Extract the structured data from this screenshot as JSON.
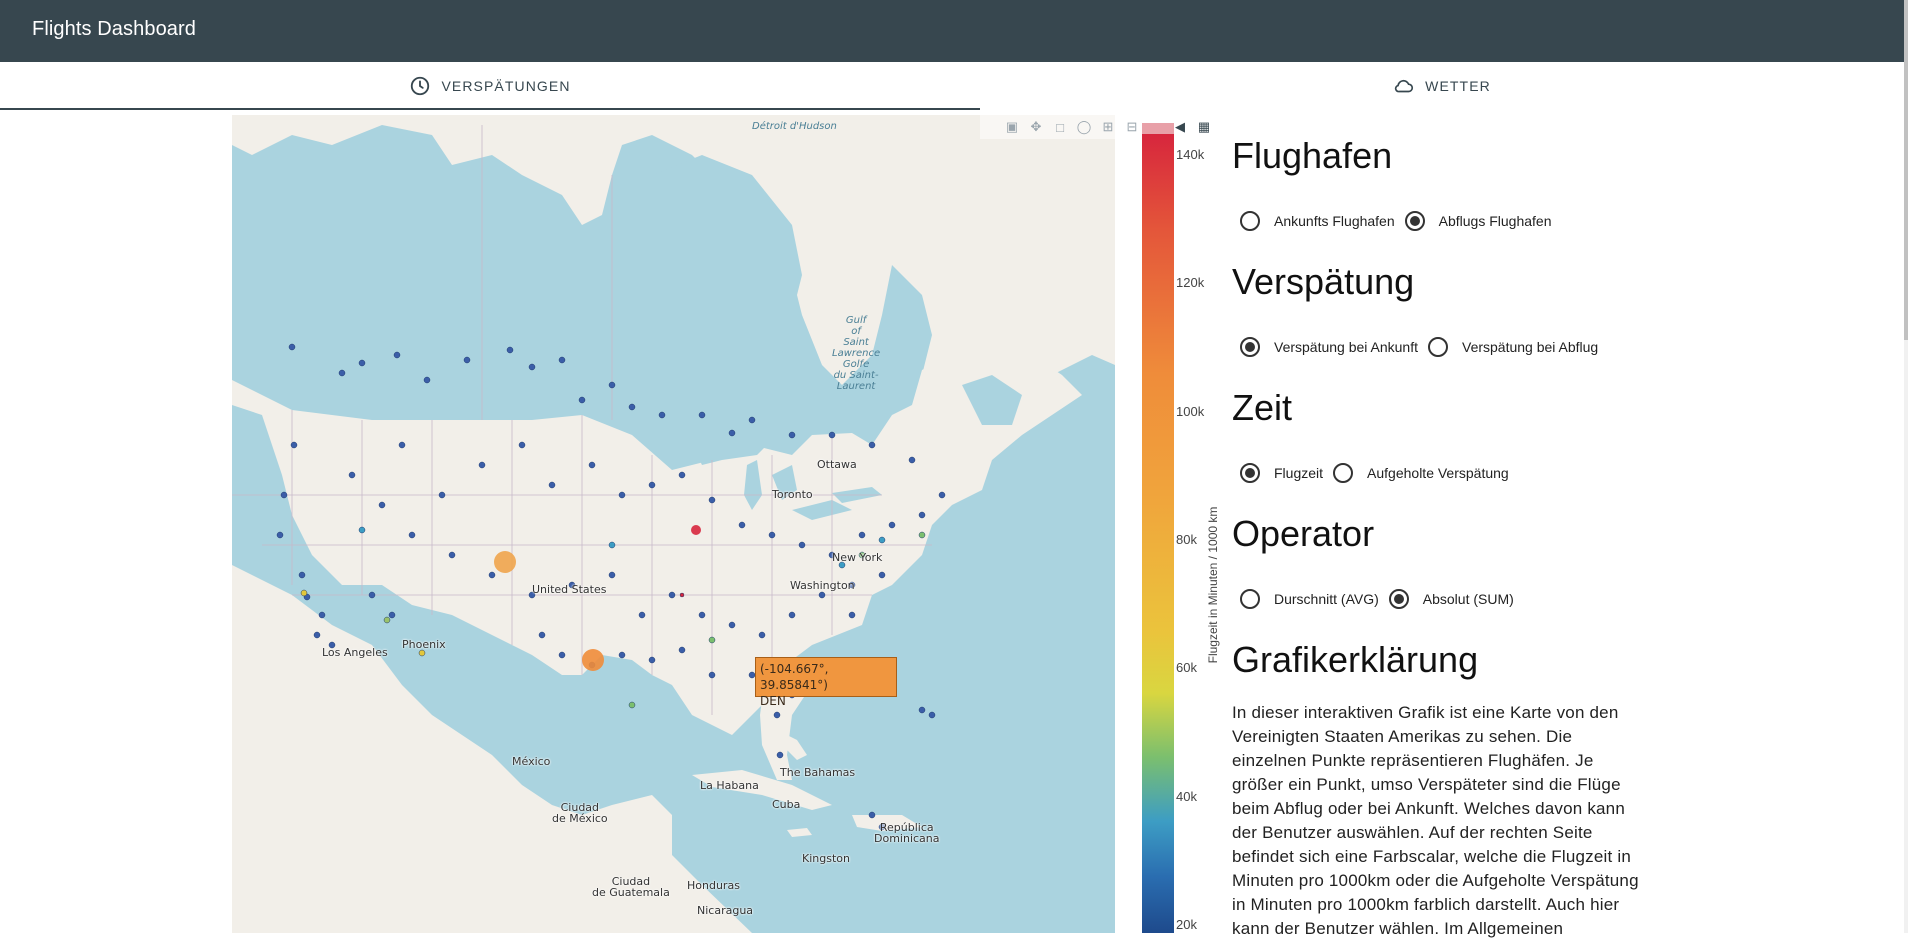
{
  "app": {
    "title": "Flights Dashboard"
  },
  "tabs": [
    {
      "label": "VERSPÄTUNGEN",
      "icon": "clock-icon",
      "active": true
    },
    {
      "label": "WETTER",
      "icon": "cloud-icon",
      "active": false
    }
  ],
  "map": {
    "labels": {
      "ottawa": "Ottawa",
      "toronto": "Toronto",
      "newyork": "New York",
      "washington": "Washington",
      "unitedstates": "United States",
      "phoenix": "Phoenix",
      "losangeles": "Los Angeles",
      "mexico": "México",
      "ciudadmexico": "Ciudad\nde México",
      "lahabana": "La Habana",
      "cuba": "Cuba",
      "bahamas": "The Bahamas",
      "republica": "República\nDominicana",
      "kingston": "Kingston",
      "honduras": "Honduras",
      "guatemala": "Ciudad\nde Guatemala",
      "nicaragua": "Nicaragua",
      "hudson": "Détroit\nd'Hudson",
      "gulf": "Gulf\nof\nSaint\nLawrence\nGolfe\ndu Saint-\nLaurent"
    },
    "tooltip": {
      "coords": "(-104.667°, 39.85841°)",
      "code": "DEN"
    }
  },
  "modebar": [
    "camera-icon",
    "pan-icon",
    "box-select-icon",
    "lasso-icon",
    "zoom-in-icon",
    "zoom-out-icon",
    "home-icon",
    "spike-icon",
    "plotly-logo-icon"
  ],
  "colorbar": {
    "title": "Flugzeit in Minuten / 1000 km",
    "ticks": [
      "140k",
      "120k",
      "100k",
      "80k",
      "60k",
      "40k",
      "20k"
    ],
    "colors": [
      "#d7263d",
      "#ef8c3a",
      "#ebc33c",
      "#7bbf6e",
      "#3d9dc4",
      "#1e4a8c"
    ]
  },
  "panel": {
    "flughafen": {
      "heading": "Flughafen",
      "options": [
        {
          "label": "Ankunfts Flughafen",
          "checked": false
        },
        {
          "label": "Abflugs Flughafen",
          "checked": true
        }
      ]
    },
    "verspaetung": {
      "heading": "Verspätung",
      "options": [
        {
          "label": "Verspätung bei Ankunft",
          "checked": true
        },
        {
          "label": "Verspätung bei Abflug",
          "checked": false
        }
      ]
    },
    "zeit": {
      "heading": "Zeit",
      "options": [
        {
          "label": "Flugzeit",
          "checked": true
        },
        {
          "label": "Aufgeholte Verspätung",
          "checked": false
        }
      ]
    },
    "operator": {
      "heading": "Operator",
      "options": [
        {
          "label": "Durschnitt (AVG)",
          "checked": false
        },
        {
          "label": "Absolut (SUM)",
          "checked": true
        }
      ]
    },
    "grafik": {
      "heading": "Grafikerklärung",
      "text": "In dieser interaktiven Grafik ist eine Karte von den Vereinigten Staaten Amerikas zu sehen. Die einzelnen Punkte repräsentieren Flughäfen. Je größer ein Punkt, umso Verspäteter sind die Flüge beim Abflug oder bei Ankunft. Welches davon kann der Benutzer auswählen. Auf der rechten Seite befindet sich eine Farbscalar, welche die Flugzeit in Minuten pro 1000km oder die Aufgeholte Verspätung in Minuten pro 1000km farblich darstellt. Auch hier kann der Benutzer wählen. Im Allgemeinen"
    }
  }
}
